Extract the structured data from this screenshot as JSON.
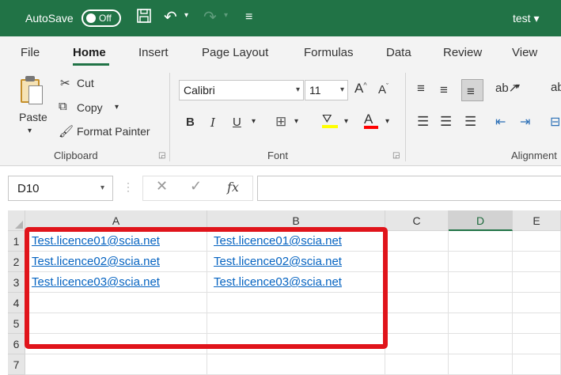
{
  "titlebar": {
    "autosave_label": "AutoSave",
    "autosave_state": "Off",
    "document_title": "test",
    "color": "#217346"
  },
  "tabs": [
    "File",
    "Home",
    "Insert",
    "Page Layout",
    "Formulas",
    "Data",
    "Review",
    "View"
  ],
  "active_tab": "Home",
  "clipboard": {
    "paste_label": "Paste",
    "cut_label": "Cut",
    "copy_label": "Copy",
    "format_painter_label": "Format Painter",
    "group_label": "Clipboard"
  },
  "font": {
    "font_name": "Calibri",
    "font_size": "11",
    "group_label": "Font",
    "fill_color": "#ffff00",
    "font_color": "#ff0000"
  },
  "alignment": {
    "group_label": "Alignment"
  },
  "formula_bar": {
    "name_box": "D10",
    "fx_label": "fx",
    "formula_value": ""
  },
  "sheet": {
    "columns": [
      "A",
      "B",
      "C",
      "D",
      "E"
    ],
    "selected_column": "D",
    "rows": [
      "1",
      "2",
      "3",
      "4",
      "5",
      "6",
      "7"
    ],
    "cells": [
      [
        "Test.licence01@scia.net",
        "Test.licence01@scia.net"
      ],
      [
        "Test.licence02@scia.net",
        "Test.licence02@scia.net"
      ],
      [
        "Test.licence03@scia.net",
        "Test.licence03@scia.net"
      ]
    ],
    "hyperlink_color": "#0563c1",
    "highlight_color": "#e0141b"
  }
}
